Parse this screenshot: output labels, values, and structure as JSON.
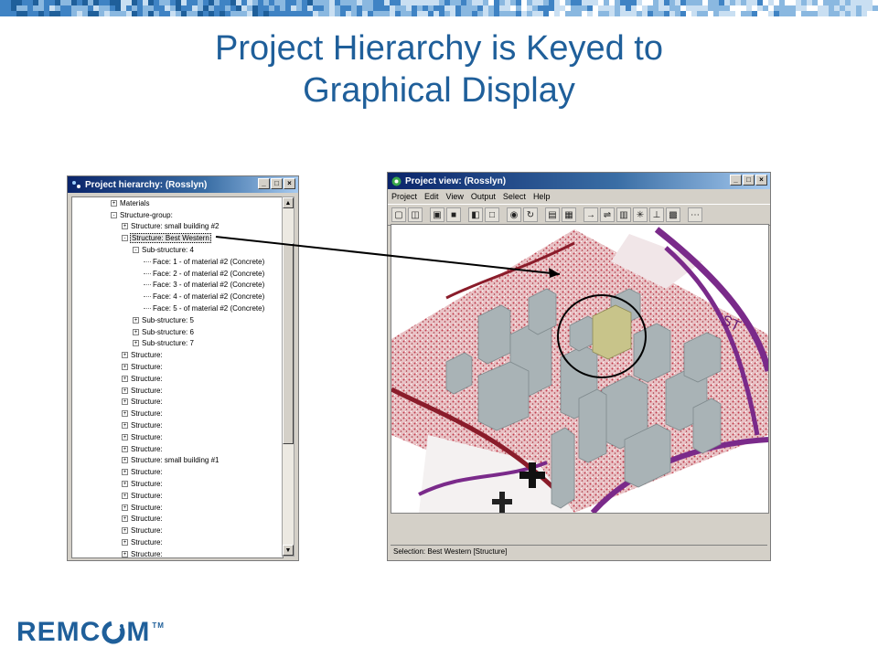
{
  "slide": {
    "title_line1": "Project Hierarchy is Keyed to",
    "title_line2": "Graphical Display"
  },
  "hierarchy_window": {
    "title": "Project hierarchy: (Rosslyn)",
    "rows": [
      {
        "indent": 0,
        "expander": "+",
        "label": "Materials"
      },
      {
        "indent": 0,
        "expander": "-",
        "label": "Structure-group:"
      },
      {
        "indent": 1,
        "expander": "+",
        "label": "Structure: small building #2"
      },
      {
        "indent": 1,
        "expander": "-",
        "label": "Structure: Best Western",
        "selected": true
      },
      {
        "indent": 2,
        "expander": "-",
        "label": "Sub-structure: 4"
      },
      {
        "indent": 3,
        "expander": "",
        "label": "Face: 1 - of material #2 (Concrete)"
      },
      {
        "indent": 3,
        "expander": "",
        "label": "Face: 2 - of material #2 (Concrete)"
      },
      {
        "indent": 3,
        "expander": "",
        "label": "Face: 3 - of material #2 (Concrete)"
      },
      {
        "indent": 3,
        "expander": "",
        "label": "Face: 4 - of material #2 (Concrete)"
      },
      {
        "indent": 3,
        "expander": "",
        "label": "Face: 5 - of material #2 (Concrete)"
      },
      {
        "indent": 2,
        "expander": "+",
        "label": "Sub-structure: 5"
      },
      {
        "indent": 2,
        "expander": "+",
        "label": "Sub-structure: 6"
      },
      {
        "indent": 2,
        "expander": "+",
        "label": "Sub-structure: 7"
      },
      {
        "indent": 1,
        "expander": "+",
        "label": "Structure:"
      },
      {
        "indent": 1,
        "expander": "+",
        "label": "Structure:"
      },
      {
        "indent": 1,
        "expander": "+",
        "label": "Structure:"
      },
      {
        "indent": 1,
        "expander": "+",
        "label": "Structure:"
      },
      {
        "indent": 1,
        "expander": "+",
        "label": "Structure:"
      },
      {
        "indent": 1,
        "expander": "+",
        "label": "Structure:"
      },
      {
        "indent": 1,
        "expander": "+",
        "label": "Structure:"
      },
      {
        "indent": 1,
        "expander": "+",
        "label": "Structure:"
      },
      {
        "indent": 1,
        "expander": "+",
        "label": "Structure:"
      },
      {
        "indent": 1,
        "expander": "+",
        "label": "Structure: small building #1"
      },
      {
        "indent": 1,
        "expander": "+",
        "label": "Structure:"
      },
      {
        "indent": 1,
        "expander": "+",
        "label": "Structure:"
      },
      {
        "indent": 1,
        "expander": "+",
        "label": "Structure:"
      },
      {
        "indent": 1,
        "expander": "+",
        "label": "Structure:"
      },
      {
        "indent": 1,
        "expander": "+",
        "label": "Structure:"
      },
      {
        "indent": 1,
        "expander": "+",
        "label": "Structure:"
      },
      {
        "indent": 1,
        "expander": "+",
        "label": "Structure:"
      },
      {
        "indent": 1,
        "expander": "+",
        "label": "Structure:"
      }
    ]
  },
  "project_view_window": {
    "title": "Project view: (Rosslyn)",
    "menu": [
      "Project",
      "Edit",
      "View",
      "Output",
      "Select",
      "Help"
    ],
    "status": "Selection: Best Western [Structure]"
  },
  "window_buttons": {
    "minimize": "_",
    "maximize": "□",
    "close": "×"
  },
  "scroll_arrows": {
    "up": "▲",
    "down": "▼"
  },
  "colors": {
    "title_blue": "#1f5f9a",
    "titlebar_start": "#0a246a",
    "selected_building": "#c8c48a",
    "map_red": "#c23a4a",
    "road_purple": "#7a2a8a",
    "building_gray": "#a9b3b6"
  },
  "logo": {
    "text": "REMC",
    "text_tail": "M",
    "tm": "TM"
  }
}
